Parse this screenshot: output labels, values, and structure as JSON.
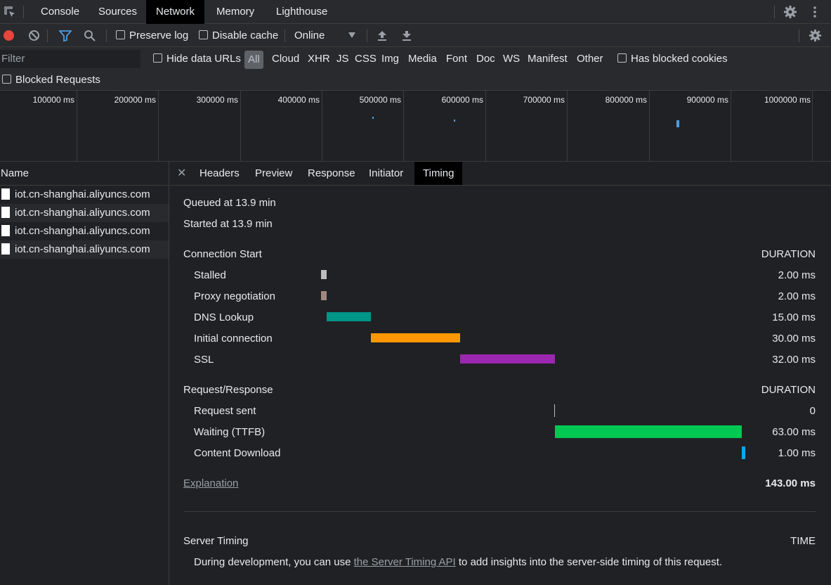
{
  "tabs": [
    "Console",
    "Sources",
    "Network",
    "Memory",
    "Lighthouse"
  ],
  "toolbar": {
    "preserve_log": "Preserve log",
    "disable_cache": "Disable cache",
    "throttle": "Online"
  },
  "filter": {
    "placeholder": "Filter",
    "hide_data_urls": "Hide data URLs",
    "types": [
      "All",
      "Cloud",
      "XHR",
      "JS",
      "CSS",
      "Img",
      "Media",
      "Font",
      "Doc",
      "WS",
      "Manifest",
      "Other"
    ],
    "has_blocked_cookies": "Has blocked cookies",
    "blocked_requests": "Blocked Requests"
  },
  "overview": {
    "ticks": [
      "100000 ms",
      "200000 ms",
      "300000 ms",
      "400000 ms",
      "500000 ms",
      "600000 ms",
      "700000 ms",
      "800000 ms",
      "900000 ms",
      "1000000 ms"
    ]
  },
  "requests": {
    "header": "Name",
    "items": [
      "iot.cn-shanghai.aliyuncs.com",
      "iot.cn-shanghai.aliyuncs.com",
      "iot.cn-shanghai.aliyuncs.com",
      "iot.cn-shanghai.aliyuncs.com"
    ]
  },
  "detail_tabs": [
    "Headers",
    "Preview",
    "Response",
    "Initiator",
    "Timing"
  ],
  "timing": {
    "queued": "Queued at 13.9 min",
    "started": "Started at 13.9 min",
    "connection_header": "Connection Start",
    "duration_label": "DURATION",
    "connection_rows": [
      {
        "label": "Stalled",
        "value": "2.00 ms",
        "color": "#bdbdbd"
      },
      {
        "label": "Proxy negotiation",
        "value": "2.00 ms",
        "color": "#a1887f"
      },
      {
        "label": "DNS Lookup",
        "value": "15.00 ms",
        "color": "#009688"
      },
      {
        "label": "Initial connection",
        "value": "30.00 ms",
        "color": "#ff9800"
      },
      {
        "label": "SSL",
        "value": "32.00 ms",
        "color": "#9c27b0"
      }
    ],
    "request_header": "Request/Response",
    "request_rows": [
      {
        "label": "Request sent",
        "value": "0",
        "color": "#bdbdbd"
      },
      {
        "label": "Waiting (TTFB)",
        "value": "63.00 ms",
        "color": "#00c853"
      },
      {
        "label": "Content Download",
        "value": "1.00 ms",
        "color": "#03a9f4"
      }
    ],
    "explanation": "Explanation",
    "total": "143.00 ms",
    "server_timing": "Server Timing",
    "time_label": "TIME",
    "server_note_prefix": "During development, you can use ",
    "server_note_link": "the Server Timing API",
    "server_note_suffix": " to add insights into the server-side timing of this request."
  }
}
